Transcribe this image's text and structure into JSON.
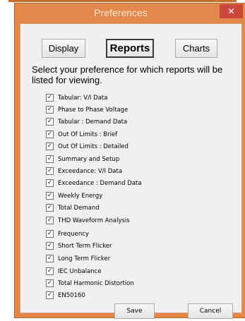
{
  "window": {
    "title": "Preferences",
    "close_glyph": "✕"
  },
  "tabs": [
    {
      "label": "Display",
      "selected": false
    },
    {
      "label": "Reports",
      "selected": true
    },
    {
      "label": "Charts",
      "selected": false
    }
  ],
  "instruction": "Select your preference for which reports will be listed for viewing.",
  "reports": [
    {
      "label": "Tabular: V/I Data",
      "checked": true
    },
    {
      "label": "Phase to Phase Voltage",
      "checked": true
    },
    {
      "label": "Tabular : Demand Data",
      "checked": true
    },
    {
      "label": "Out Of Limits : Brief",
      "checked": true
    },
    {
      "label": "Out Of Limits : Detailed",
      "checked": true
    },
    {
      "label": "Summary and Setup",
      "checked": true
    },
    {
      "label": "Exceedance: V/I Data",
      "checked": true
    },
    {
      "label": "Exceedance : Demand Data",
      "checked": true
    },
    {
      "label": "Weekly Energy",
      "checked": true
    },
    {
      "label": "Total Demand",
      "checked": true
    },
    {
      "label": "THD Waveform Analysis",
      "checked": true
    },
    {
      "label": "Frequency",
      "checked": true
    },
    {
      "label": "Short Term Flicker",
      "checked": true
    },
    {
      "label": "Long Term Flicker",
      "checked": true
    },
    {
      "label": "IEC Unbalance",
      "checked": true
    },
    {
      "label": "Total Harmonic Distortion",
      "checked": true
    },
    {
      "label": "EN50160",
      "checked": true
    }
  ],
  "buttons": {
    "save_label": "Save",
    "cancel_label": "Cancel"
  },
  "colors": {
    "window_frame": "#e1884a",
    "close_button": "#c9473b",
    "client_background": "#f0f0f0"
  }
}
